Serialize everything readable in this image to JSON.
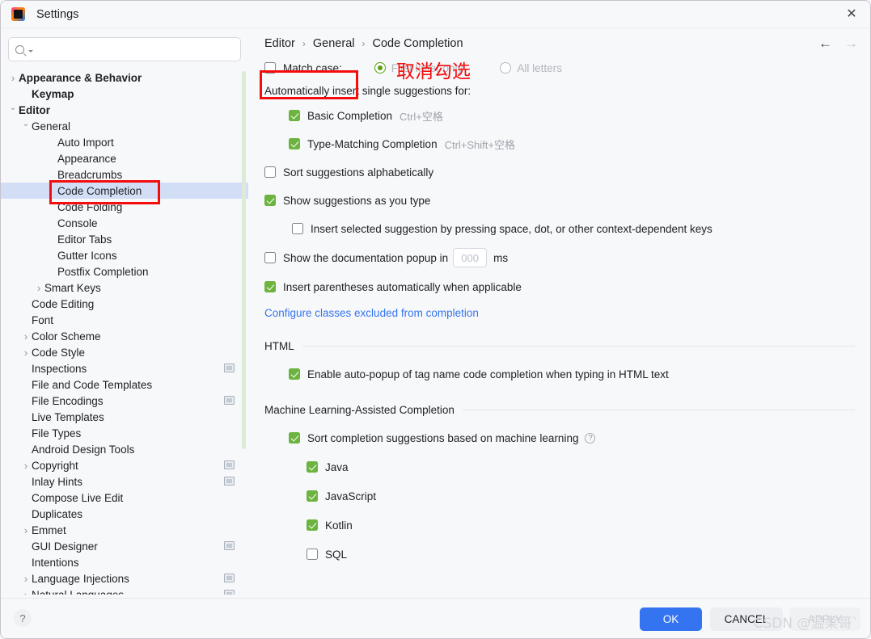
{
  "window": {
    "title": "Settings",
    "app_icon": "intellij-idea-logo",
    "close_icon": "close-icon"
  },
  "sidebar": {
    "search": {
      "placeholder": "",
      "value": "",
      "icon": "search-icon"
    },
    "items": [
      {
        "label": "Appearance & Behavior",
        "indent": 0,
        "arrow": "collapsed",
        "bold": true,
        "selected": false,
        "module_icon": false
      },
      {
        "label": "Keymap",
        "indent": 1,
        "arrow": "none",
        "bold": true,
        "selected": false,
        "module_icon": false
      },
      {
        "label": "Editor",
        "indent": 0,
        "arrow": "expanded",
        "bold": true,
        "selected": false,
        "module_icon": false
      },
      {
        "label": "General",
        "indent": 1,
        "arrow": "expanded",
        "bold": false,
        "selected": false,
        "module_icon": false
      },
      {
        "label": "Auto Import",
        "indent": 3,
        "arrow": "none",
        "bold": false,
        "selected": false,
        "module_icon": false
      },
      {
        "label": "Appearance",
        "indent": 3,
        "arrow": "none",
        "bold": false,
        "selected": false,
        "module_icon": false
      },
      {
        "label": "Breadcrumbs",
        "indent": 3,
        "arrow": "none",
        "bold": false,
        "selected": false,
        "module_icon": false
      },
      {
        "label": "Code Completion",
        "indent": 3,
        "arrow": "none",
        "bold": false,
        "selected": true,
        "module_icon": false
      },
      {
        "label": "Code Folding",
        "indent": 3,
        "arrow": "none",
        "bold": false,
        "selected": false,
        "module_icon": false
      },
      {
        "label": "Console",
        "indent": 3,
        "arrow": "none",
        "bold": false,
        "selected": false,
        "module_icon": false
      },
      {
        "label": "Editor Tabs",
        "indent": 3,
        "arrow": "none",
        "bold": false,
        "selected": false,
        "module_icon": false
      },
      {
        "label": "Gutter Icons",
        "indent": 3,
        "arrow": "none",
        "bold": false,
        "selected": false,
        "module_icon": false
      },
      {
        "label": "Postfix Completion",
        "indent": 3,
        "arrow": "none",
        "bold": false,
        "selected": false,
        "module_icon": false
      },
      {
        "label": "Smart Keys",
        "indent": 2,
        "arrow": "collapsed",
        "bold": false,
        "selected": false,
        "module_icon": false
      },
      {
        "label": "Code Editing",
        "indent": 1,
        "arrow": "none",
        "bold": false,
        "selected": false,
        "module_icon": false
      },
      {
        "label": "Font",
        "indent": 1,
        "arrow": "none",
        "bold": false,
        "selected": false,
        "module_icon": false
      },
      {
        "label": "Color Scheme",
        "indent": 1,
        "arrow": "collapsed",
        "bold": false,
        "selected": false,
        "module_icon": false
      },
      {
        "label": "Code Style",
        "indent": 1,
        "arrow": "collapsed",
        "bold": false,
        "selected": false,
        "module_icon": false
      },
      {
        "label": "Inspections",
        "indent": 1,
        "arrow": "none",
        "bold": false,
        "selected": false,
        "module_icon": true
      },
      {
        "label": "File and Code Templates",
        "indent": 1,
        "arrow": "none",
        "bold": false,
        "selected": false,
        "module_icon": false
      },
      {
        "label": "File Encodings",
        "indent": 1,
        "arrow": "none",
        "bold": false,
        "selected": false,
        "module_icon": true
      },
      {
        "label": "Live Templates",
        "indent": 1,
        "arrow": "none",
        "bold": false,
        "selected": false,
        "module_icon": false
      },
      {
        "label": "File Types",
        "indent": 1,
        "arrow": "none",
        "bold": false,
        "selected": false,
        "module_icon": false
      },
      {
        "label": "Android Design Tools",
        "indent": 1,
        "arrow": "none",
        "bold": false,
        "selected": false,
        "module_icon": false
      },
      {
        "label": "Copyright",
        "indent": 1,
        "arrow": "collapsed",
        "bold": false,
        "selected": false,
        "module_icon": true
      },
      {
        "label": "Inlay Hints",
        "indent": 1,
        "arrow": "none",
        "bold": false,
        "selected": false,
        "module_icon": true
      },
      {
        "label": "Compose Live Edit",
        "indent": 1,
        "arrow": "none",
        "bold": false,
        "selected": false,
        "module_icon": false
      },
      {
        "label": "Duplicates",
        "indent": 1,
        "arrow": "none",
        "bold": false,
        "selected": false,
        "module_icon": false
      },
      {
        "label": "Emmet",
        "indent": 1,
        "arrow": "collapsed",
        "bold": false,
        "selected": false,
        "module_icon": false
      },
      {
        "label": "GUI Designer",
        "indent": 1,
        "arrow": "none",
        "bold": false,
        "selected": false,
        "module_icon": true
      },
      {
        "label": "Intentions",
        "indent": 1,
        "arrow": "none",
        "bold": false,
        "selected": false,
        "module_icon": false
      },
      {
        "label": "Language Injections",
        "indent": 1,
        "arrow": "collapsed",
        "bold": false,
        "selected": false,
        "module_icon": true
      },
      {
        "label": "Natural Languages",
        "indent": 1,
        "arrow": "collapsed",
        "bold": false,
        "selected": false,
        "module_icon": true
      }
    ]
  },
  "breadcrumb": {
    "parts": [
      "Editor",
      "General",
      "Code Completion"
    ],
    "separator": "›",
    "back_icon": "arrow-left-icon",
    "forward_icon": "arrow-right-icon"
  },
  "main": {
    "match_case": {
      "label": "Match case:",
      "checked": false
    },
    "match_case_options": [
      {
        "label": "First letter only",
        "selected": true,
        "disabled": true
      },
      {
        "label": "All letters",
        "selected": false,
        "disabled": true
      }
    ],
    "auto_insert_heading": "Automatically insert single suggestions for:",
    "auto_insert_items": [
      {
        "label": "Basic Completion",
        "shortcut": "Ctrl+空格",
        "checked": true
      },
      {
        "label": "Type-Matching Completion",
        "shortcut": "Ctrl+Shift+空格",
        "checked": true
      }
    ],
    "sort_alpha": {
      "label": "Sort suggestions alphabetically",
      "checked": false
    },
    "show_as_you_type": {
      "label": "Show suggestions as you type",
      "checked": true
    },
    "insert_selected": {
      "label": "Insert selected suggestion by pressing space, dot, or other context-dependent keys",
      "checked": false
    },
    "doc_popup": {
      "label": "Show the documentation popup in",
      "checked": false,
      "value_placeholder": "000",
      "unit": "ms"
    },
    "insert_parens": {
      "label": "Insert parentheses automatically when applicable",
      "checked": true
    },
    "excluded_link": "Configure classes excluded from completion",
    "html_section": {
      "title": "HTML",
      "items": [
        {
          "label": "Enable auto-popup of tag name code completion when typing in HTML text",
          "checked": true
        }
      ]
    },
    "ml_section": {
      "title": "Machine Learning-Assisted Completion",
      "main_item": {
        "label": "Sort completion suggestions based on machine learning",
        "checked": true,
        "help_icon": "question-mark-icon"
      },
      "languages": [
        {
          "label": "Java",
          "checked": true
        },
        {
          "label": "JavaScript",
          "checked": true
        },
        {
          "label": "Kotlin",
          "checked": true
        },
        {
          "label": "SQL",
          "checked": false
        }
      ]
    }
  },
  "annotations": {
    "text": "取消勾选",
    "color": "#f50c0c"
  },
  "footer": {
    "help_icon": "question-mark-icon",
    "ok": "OK",
    "cancel": "CANCEL",
    "apply": "APPLY"
  },
  "watermark": "CSDN @温柔哥`"
}
